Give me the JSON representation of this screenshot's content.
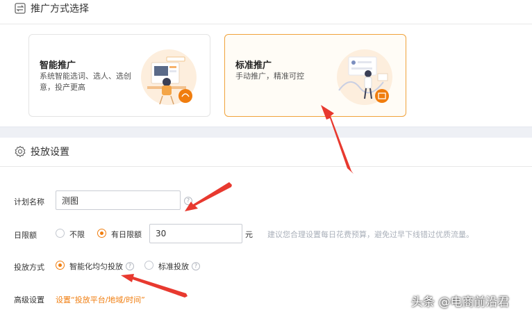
{
  "promo_section": {
    "title": "推广方式选择",
    "cards": [
      {
        "title": "智能推广",
        "desc": "系统智能选词、选人、选创意，投产更高"
      },
      {
        "title": "标准推广",
        "desc": "手动推广，精准可控"
      }
    ]
  },
  "delivery_section": {
    "title": "投放设置",
    "plan_name": {
      "label": "计划名称",
      "value": "测图"
    },
    "daily_limit": {
      "label": "日限额",
      "option_unlimited": "不限",
      "option_limited": "有日限额",
      "value": "30",
      "unit": "元",
      "hint": "建议您合理设置每日花费预算，避免过早下线错过优质流量。"
    },
    "delivery_method": {
      "label": "投放方式",
      "option_smart": "智能化均匀投放",
      "option_standard": "标准投放"
    },
    "advanced": {
      "label": "高级设置",
      "link": "设置“投放平台/地域/时间”"
    }
  },
  "watermark": "头条 @电商前沿君",
  "colors": {
    "accent": "#f07d0e",
    "arrow": "#e8392f",
    "selected_border": "#f0a23a"
  }
}
